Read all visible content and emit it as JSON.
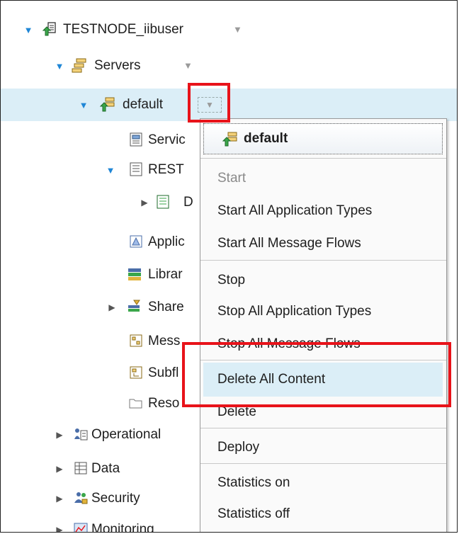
{
  "tree": {
    "node": "TESTNODE_iibuser",
    "servers": "Servers",
    "server": "default",
    "services": "Servic",
    "rest": "REST",
    "rest_child": "D",
    "applications": "Applic",
    "libraries": "Librar",
    "shared": "Share",
    "messages": "Mess",
    "subflows": "Subfl",
    "resources": "Reso",
    "operational": "Operational",
    "data": "Data",
    "security": "Security",
    "monitoring": "Monitoring"
  },
  "menu": {
    "header": "default",
    "start": "Start",
    "start_all_app_types": "Start All Application Types",
    "start_all_flows": "Start All Message Flows",
    "stop": "Stop",
    "stop_all_app_types": "Stop All Application Types",
    "stop_all_flows": "Stop All Message Flows",
    "delete_all_content": "Delete All Content",
    "delete": "Delete",
    "deploy": "Deploy",
    "stats_on": "Statistics on",
    "stats_off": "Statistics off"
  },
  "colors": {
    "accent": "#1f86d6",
    "selection": "#dbeef7",
    "highlight_box": "#e8131a"
  }
}
